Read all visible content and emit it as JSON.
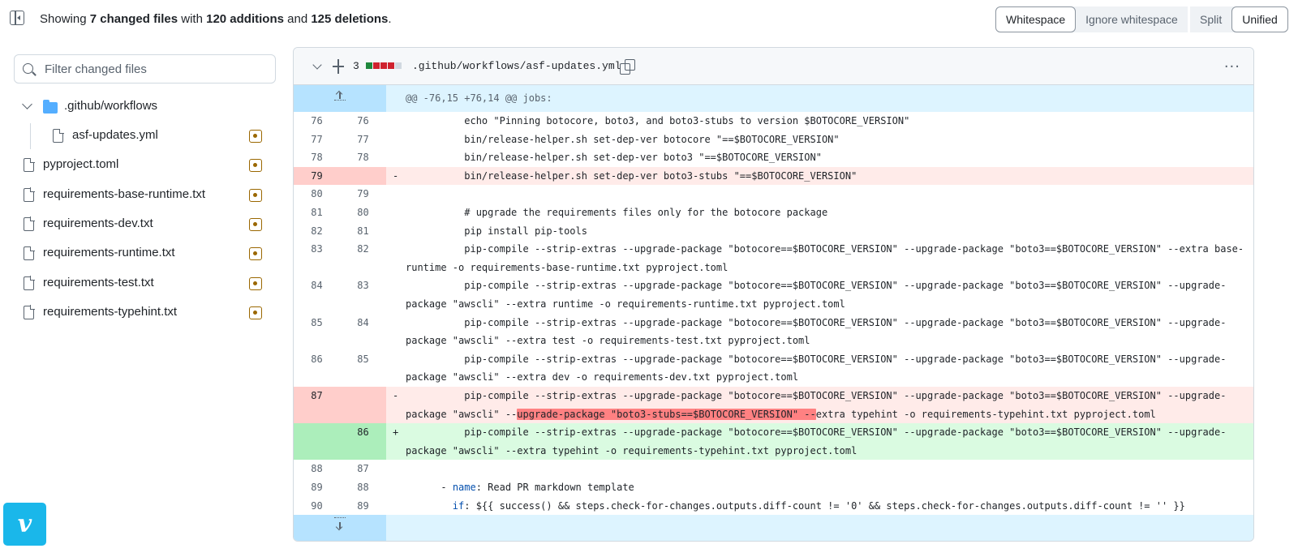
{
  "summary": {
    "prefix": "Showing ",
    "changed_files": "7 changed files",
    "with": " with ",
    "additions": "120 additions",
    "and": " and ",
    "deletions": "125 deletions",
    "suffix": "."
  },
  "whitespace_toggle": {
    "whitespace": "Whitespace",
    "ignore": "Ignore whitespace",
    "active": "Whitespace"
  },
  "view_toggle": {
    "split": "Split",
    "unified": "Unified",
    "active": "Unified"
  },
  "filter": {
    "placeholder": "Filter changed files",
    "value": ""
  },
  "file_tree": {
    "folder": ".github/workflows",
    "files": [
      {
        "name": "asf-updates.yml",
        "status": "modified",
        "nested": true
      },
      {
        "name": "pyproject.toml",
        "status": "modified",
        "nested": false
      },
      {
        "name": "requirements-base-runtime.txt",
        "status": "modified",
        "nested": false
      },
      {
        "name": "requirements-dev.txt",
        "status": "modified",
        "nested": false
      },
      {
        "name": "requirements-runtime.txt",
        "status": "modified",
        "nested": false
      },
      {
        "name": "requirements-test.txt",
        "status": "modified",
        "nested": false
      },
      {
        "name": "requirements-typehint.txt",
        "status": "modified",
        "nested": false
      }
    ]
  },
  "diff": {
    "change_count": "3",
    "diffstat": [
      "add",
      "del",
      "del",
      "del",
      "neutral"
    ],
    "colors": {
      "add": "#1f883d",
      "del": "#cf222e",
      "neutral": "#d1d9e0"
    },
    "file_path": ".github/workflows/asf-updates.yml",
    "hunk_header": "@@ -76,15 +76,14 @@ jobs:",
    "lines": [
      {
        "type": "ctx",
        "old": "76",
        "new": "76",
        "code": "          echo \"Pinning botocore, boto3, and boto3-stubs to version $BOTOCORE_VERSION\""
      },
      {
        "type": "ctx",
        "old": "77",
        "new": "77",
        "code": "          bin/release-helper.sh set-dep-ver botocore \"==$BOTOCORE_VERSION\""
      },
      {
        "type": "ctx",
        "old": "78",
        "new": "78",
        "code": "          bin/release-helper.sh set-dep-ver boto3 \"==$BOTOCORE_VERSION\""
      },
      {
        "type": "del",
        "old": "79",
        "new": "",
        "code": "          bin/release-helper.sh set-dep-ver boto3-stubs \"==$BOTOCORE_VERSION\""
      },
      {
        "type": "ctx",
        "old": "80",
        "new": "79",
        "code": ""
      },
      {
        "type": "ctx",
        "old": "81",
        "new": "80",
        "code": "          # upgrade the requirements files only for the botocore package"
      },
      {
        "type": "ctx",
        "old": "82",
        "new": "81",
        "code": "          pip install pip-tools"
      },
      {
        "type": "ctx",
        "old": "83",
        "new": "82",
        "code": "          pip-compile --strip-extras --upgrade-package \"botocore==$BOTOCORE_VERSION\" --upgrade-package \"boto3==$BOTOCORE_VERSION\" --extra base-runtime -o requirements-base-runtime.txt pyproject.toml"
      },
      {
        "type": "ctx",
        "old": "84",
        "new": "83",
        "code": "          pip-compile --strip-extras --upgrade-package \"botocore==$BOTOCORE_VERSION\" --upgrade-package \"boto3==$BOTOCORE_VERSION\" --upgrade-package \"awscli\" --extra runtime -o requirements-runtime.txt pyproject.toml"
      },
      {
        "type": "ctx",
        "old": "85",
        "new": "84",
        "code": "          pip-compile --strip-extras --upgrade-package \"botocore==$BOTOCORE_VERSION\" --upgrade-package \"boto3==$BOTOCORE_VERSION\" --upgrade-package \"awscli\" --extra test -o requirements-test.txt pyproject.toml"
      },
      {
        "type": "ctx",
        "old": "86",
        "new": "85",
        "code": "          pip-compile --strip-extras --upgrade-package \"botocore==$BOTOCORE_VERSION\" --upgrade-package \"boto3==$BOTOCORE_VERSION\" --upgrade-package \"awscli\" --extra dev -o requirements-dev.txt pyproject.toml"
      },
      {
        "type": "del",
        "old": "87",
        "new": "",
        "code_pre": "          pip-compile --strip-extras --upgrade-package \"botocore==$BOTOCORE_VERSION\" --upgrade-package \"boto3==$BOTOCORE_VERSION\" --upgrade-package \"awscli\" --",
        "code_hl": "upgrade-package \"boto3-stubs==$BOTOCORE_VERSION\" --",
        "code_post": "extra typehint -o requirements-typehint.txt pyproject.toml"
      },
      {
        "type": "add",
        "old": "",
        "new": "86",
        "code": "          pip-compile --strip-extras --upgrade-package \"botocore==$BOTOCORE_VERSION\" --upgrade-package \"boto3==$BOTOCORE_VERSION\" --upgrade-package \"awscli\" --extra typehint -o requirements-typehint.txt pyproject.toml"
      },
      {
        "type": "ctx",
        "old": "88",
        "new": "87",
        "code": ""
      },
      {
        "type": "ctx",
        "old": "89",
        "new": "88",
        "code_indent": "      - ",
        "code_key": "name",
        "code_rest": ": Read PR markdown template"
      },
      {
        "type": "ctx",
        "old": "90",
        "new": "89",
        "code_indent": "        ",
        "code_key": "if",
        "code_rest": ": ${{ success() && steps.check-for-changes.outputs.diff-count != '0' && steps.check-for-changes.outputs.diff-count != '' }}"
      }
    ]
  },
  "badge": {
    "label": "v"
  }
}
